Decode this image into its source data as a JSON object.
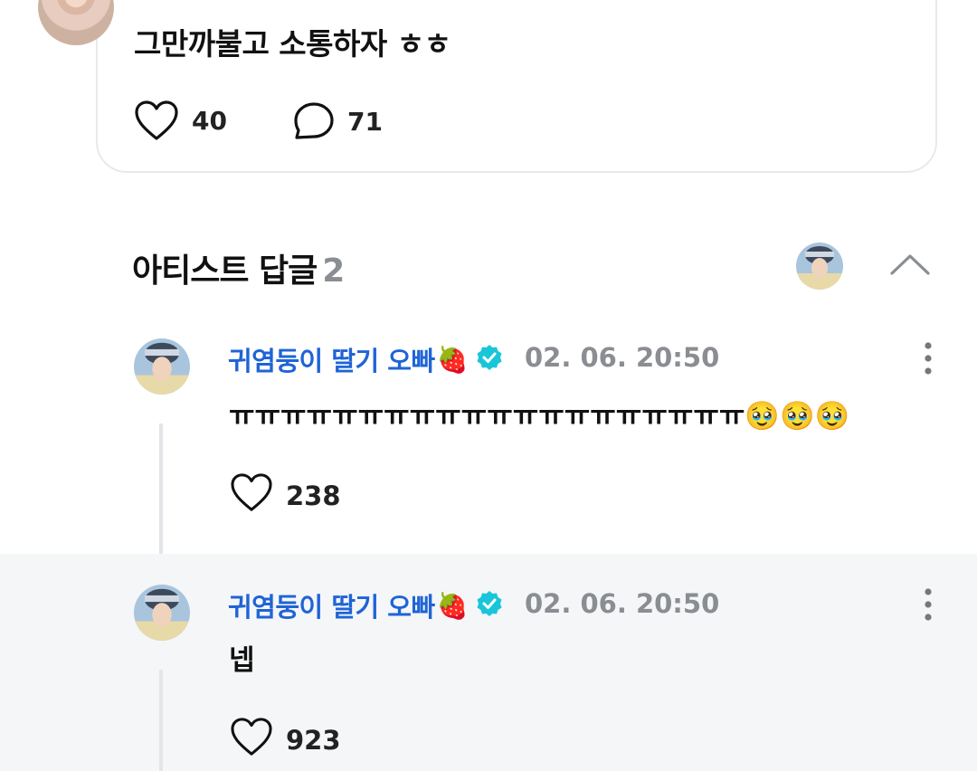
{
  "post": {
    "text": "그만까불고 소통하자 ㅎㅎ",
    "likes": "40",
    "comments": "71",
    "like_icon": "heart-outline-icon",
    "comment_icon": "speech-bubble-icon"
  },
  "section": {
    "title": "아티스트 답글",
    "count": "2",
    "collapse_icon": "chevron-up-icon"
  },
  "replies": [
    {
      "author": "귀염둥이 딸기 오빠",
      "emoji": "🍓",
      "verified_icon": "verified-badge-icon",
      "verified_color": "#19c6d9",
      "date": "02. 06. 20:50",
      "body": "ㅠㅠㅠㅠㅠㅠㅠㅠㅠㅠㅠㅠㅠㅠㅠㅠㅠㅠㅠㅠ🥹🥹🥹",
      "likes": "238"
    },
    {
      "author": "귀염둥이 딸기 오빠",
      "emoji": "🍓",
      "verified_icon": "verified-badge-icon",
      "verified_color": "#19c6d9",
      "date": "02. 06. 20:50",
      "body": "넵",
      "likes": "923"
    }
  ],
  "colors": {
    "author_blue": "#1f64d6",
    "muted_gray": "#8a8d91",
    "highlight_bg": "#f5f6f8"
  }
}
